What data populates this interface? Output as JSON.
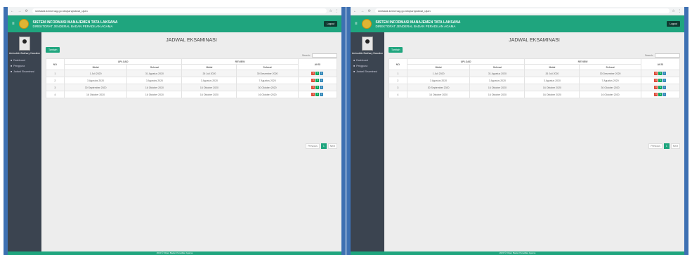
{
  "browser": {
    "url": "simtalak.kemenag.go.id/ujian/jadwal_ujian"
  },
  "header": {
    "title": "SISTEM INFORMASI MANAJEMEN TATA LAKSANA",
    "subtitle": "DIREKTORAT JENDERAL BADAN PERADILAN AGAMA",
    "logout_label": "Logout"
  },
  "sidebar": {
    "user_name": "Amiruddin Bakhary Nasution",
    "items": [
      {
        "label": "Dashboard"
      },
      {
        "label": "Pengguna"
      },
      {
        "label": "Jadwal Eksaminasi"
      }
    ]
  },
  "main": {
    "title": "JADWAL EKSAMINASI",
    "add_label": "Tambah",
    "search_label": "Search:",
    "columns": {
      "no": "NO",
      "upload": "UPLOAD",
      "review": "REVIEW",
      "mulai": "Mulai",
      "selesai": "Selesai",
      "aksi": "AKSI"
    },
    "rows": [
      {
        "no": "1",
        "upload_mulai": "1 Juli 2020",
        "upload_selesai": "31 Agustus 2020",
        "review_mulai": "26 Juli 2020",
        "review_selesai": "30 Desember 2020"
      },
      {
        "no": "2",
        "upload_mulai": "3 Agustus 2020",
        "upload_selesai": "3 Agustus 2020",
        "review_mulai": "3 Agustus 2020",
        "review_selesai": "7 Agustus 2020"
      },
      {
        "no": "3",
        "upload_mulai": "30 September 2020",
        "upload_selesai": "16 Oktober 2020",
        "review_mulai": "16 Oktober 2020",
        "review_selesai": "30 Oktober 2020"
      },
      {
        "no": "4",
        "upload_mulai": "16 Oktober 2020",
        "upload_selesai": "16 Oktober 2020",
        "review_mulai": "16 Oktober 2020",
        "review_selesai": "16 Oktober 2020"
      }
    ],
    "pagination": {
      "previous": "Previous",
      "current": "1",
      "next": "Next"
    }
  },
  "footer": {
    "text": "2020 © Dirjen Badan Peradilan Agama"
  },
  "colors": {
    "primary": "#1fa57e",
    "sidebar": "#3b4450",
    "frame": "#3d70b2"
  }
}
